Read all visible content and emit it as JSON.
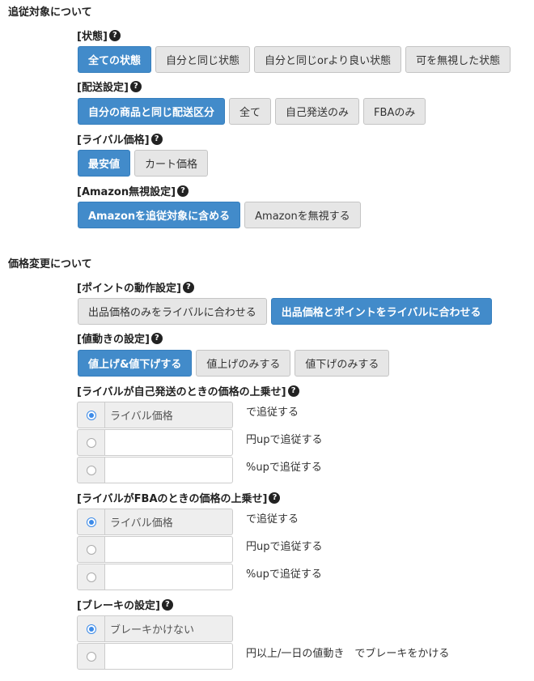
{
  "tracking": {
    "title": "追従対象について",
    "condition": {
      "label": "[状態]",
      "options": [
        "全ての状態",
        "自分と同じ状態",
        "自分と同じorより良い状態",
        "可を無視した状態"
      ]
    },
    "shipping": {
      "label": "[配送設定]",
      "options": [
        "自分の商品と同じ配送区分",
        "全て",
        "自己発送のみ",
        "FBAのみ"
      ]
    },
    "rival_price": {
      "label": "[ライバル価格]",
      "options": [
        "最安値",
        "カート価格"
      ]
    },
    "amazon_ignore": {
      "label": "[Amazon無視設定]",
      "options": [
        "Amazonを追従対象に含める",
        "Amazonを無視する"
      ]
    }
  },
  "price_change": {
    "title": "価格変更について",
    "points": {
      "label": "[ポイントの動作設定]",
      "options": [
        "出品価格のみをライバルに合わせる",
        "出品価格とポイントをライバルに合わせる"
      ]
    },
    "movement": {
      "label": "[値動きの設定]",
      "options": [
        "値上げ&値下げする",
        "値上げのみする",
        "値下げのみする"
      ]
    },
    "self_ship_markup": {
      "label": "[ライバルが自己発送のときの価格の上乗せ]",
      "row1_value": "ライバル価格",
      "row1_suffix": "で追従する",
      "row2_suffix": "円upで追従する",
      "row3_suffix": "%upで追従する"
    },
    "fba_markup": {
      "label": "[ライバルがFBAのときの価格の上乗せ]",
      "row1_value": "ライバル価格",
      "row1_suffix": "で追従する",
      "row2_suffix": "円upで追従する",
      "row3_suffix": "%upで追従する"
    },
    "brake": {
      "label": "[ブレーキの設定]",
      "row1_value": "ブレーキかけない",
      "row2_suffix": "円以上/一日の値動き　でブレーキをかける"
    }
  },
  "help_glyph": "?"
}
